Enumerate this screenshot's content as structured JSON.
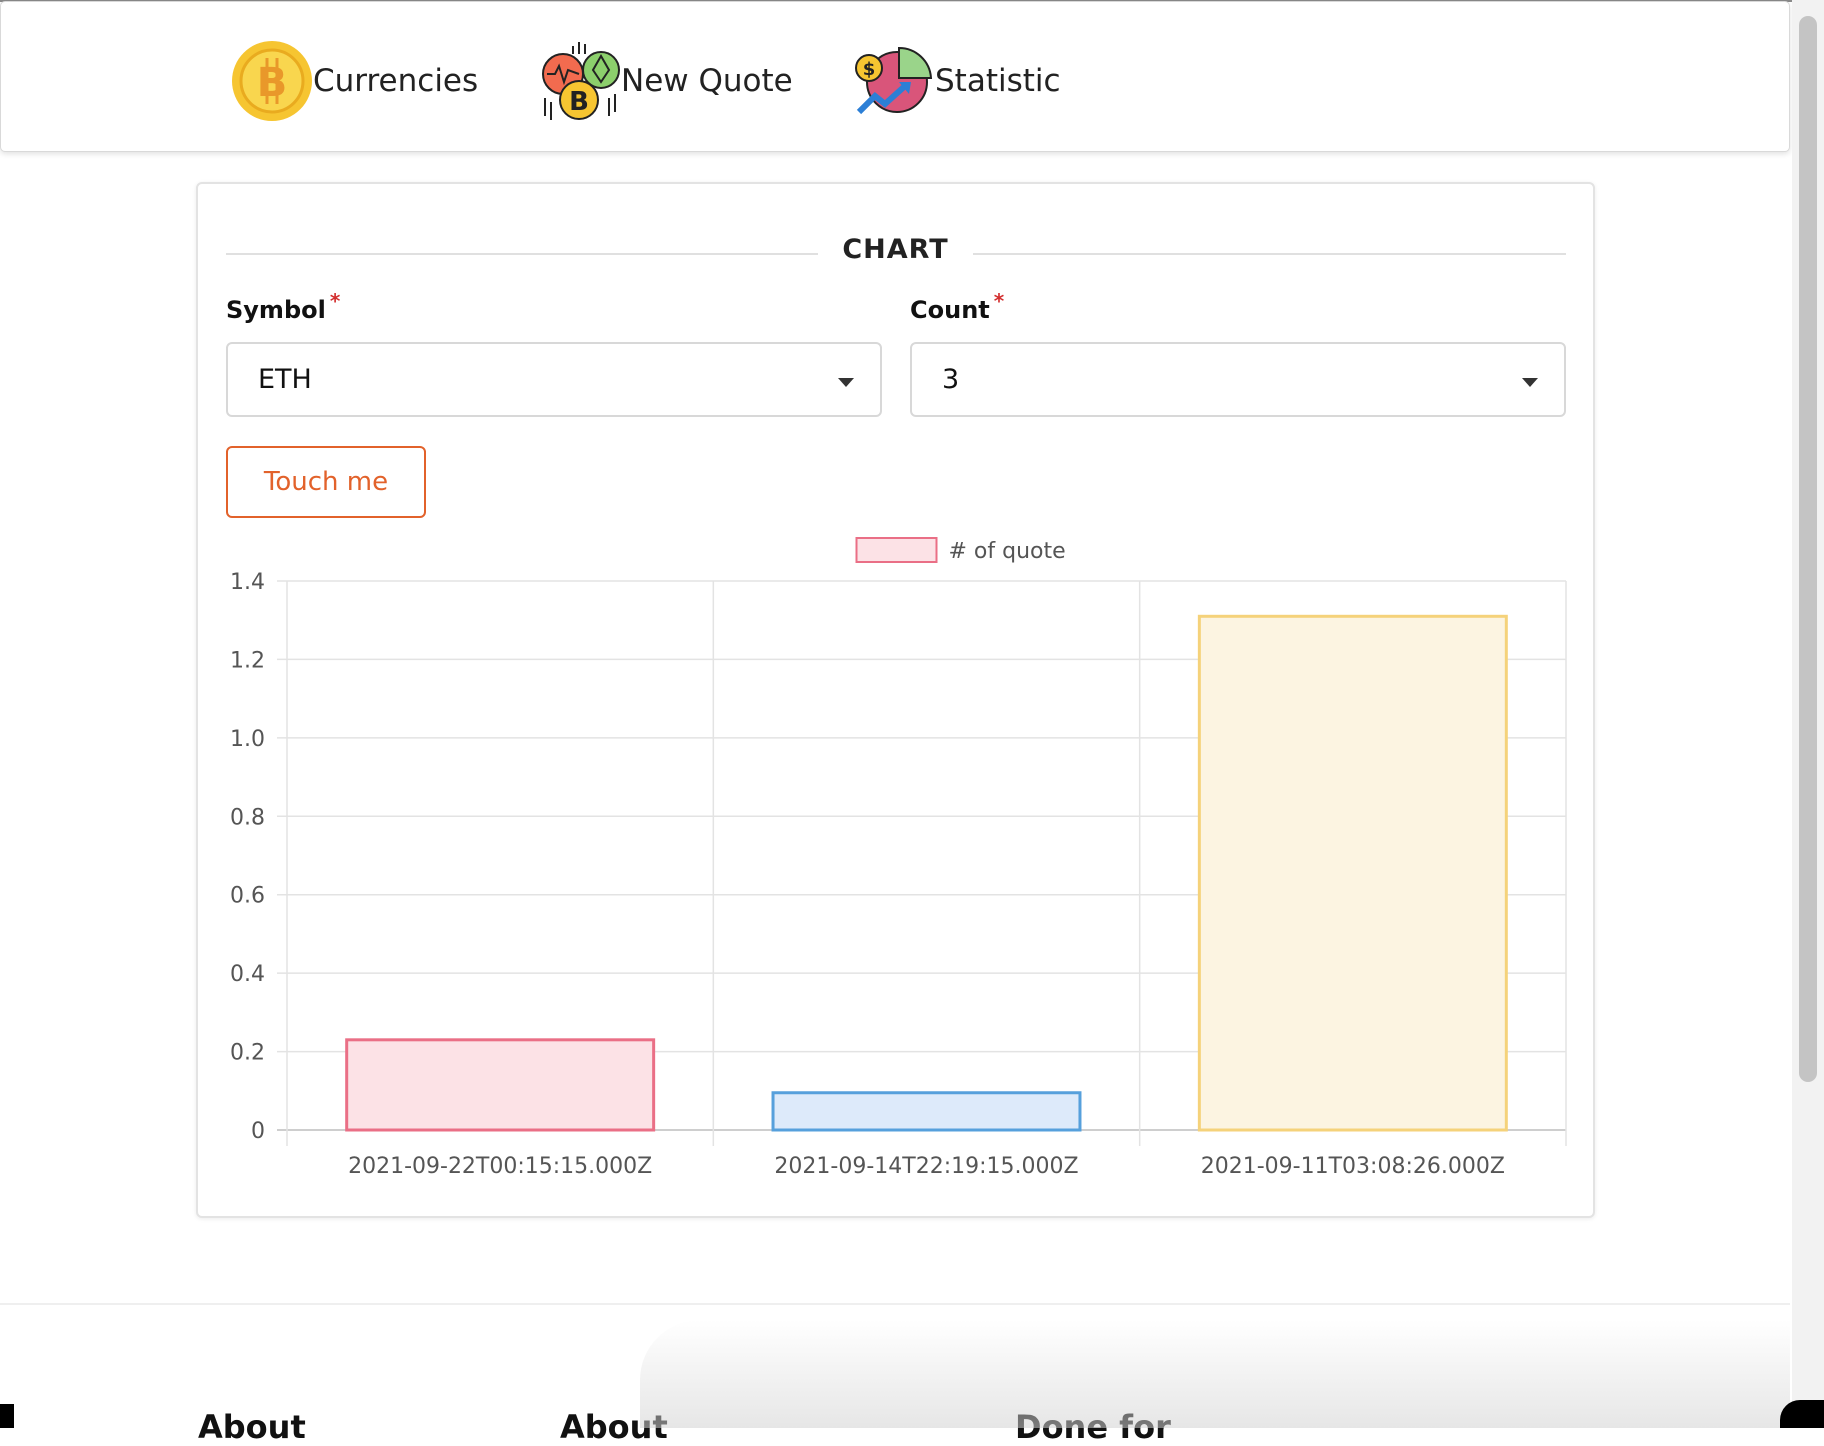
{
  "nav": {
    "items": [
      {
        "label": "Currencies",
        "icon": "bitcoin-coin-icon"
      },
      {
        "label": "New Quote",
        "icon": "crypto-coins-icon"
      },
      {
        "label": "Statistic",
        "icon": "statistics-pie-icon"
      }
    ]
  },
  "card": {
    "title": "CHART",
    "symbol": {
      "label": "Symbol",
      "required": "*",
      "value": "ETH"
    },
    "count": {
      "label": "Count",
      "required": "*",
      "value": "3"
    },
    "button_label": "Touch me"
  },
  "chart_data": {
    "type": "bar",
    "categories": [
      "2021-09-22T00:15:15.000Z",
      "2021-09-14T22:19:15.000Z",
      "2021-09-11T03:08:26.000Z"
    ],
    "series": [
      {
        "name": "# of quote",
        "values": [
          0.23,
          0.095,
          1.31
        ]
      }
    ],
    "bar_colors": [
      {
        "fill": "#fce2e6",
        "stroke": "#ea6f86"
      },
      {
        "fill": "#ddeafa",
        "stroke": "#56a0dc"
      },
      {
        "fill": "#fcf4e1",
        "stroke": "#f5d27a"
      }
    ],
    "ylim": [
      0,
      1.4
    ],
    "yticks": [
      "0",
      "0.2",
      "0.4",
      "0.6",
      "0.8",
      "1.0",
      "1.2",
      "1.4"
    ],
    "grid": true,
    "legend_position": "top-center"
  },
  "footer": {
    "headings": [
      "About",
      "About",
      "Done for"
    ]
  },
  "colors": {
    "accent": "#e2622b",
    "required": "#d32f2f"
  }
}
